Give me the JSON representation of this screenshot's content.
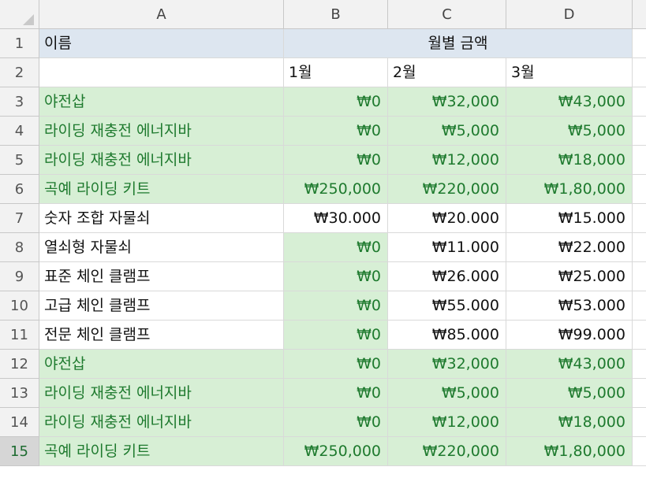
{
  "columns": [
    "A",
    "B",
    "C",
    "D"
  ],
  "row_numbers": [
    "1",
    "2",
    "3",
    "4",
    "5",
    "6",
    "7",
    "8",
    "9",
    "10",
    "11",
    "12",
    "13",
    "14",
    "15"
  ],
  "row1": {
    "a": "이름",
    "merged_title": "월별 금액"
  },
  "row2": {
    "b": "1월",
    "c": "2월",
    "d": "3월"
  },
  "rows": [
    {
      "a": "야전삽",
      "b": "₩0",
      "c": "₩32,000",
      "d": "₩43,000"
    },
    {
      "a": "라이딩 재충전 에너지바",
      "b": "₩0",
      "c": "₩5,000",
      "d": "₩5,000"
    },
    {
      "a": "라이딩 재충전 에너지바",
      "b": "₩0",
      "c": "₩12,000",
      "d": "₩18,000"
    },
    {
      "a": "곡예 라이딩 키트",
      "b": "₩250,000",
      "c": "₩220,000",
      "d": "₩1,80,000"
    },
    {
      "a": "숫자 조합 자물쇠",
      "b": "₩30.000",
      "c": "₩20.000",
      "d": "₩15.000"
    },
    {
      "a": "열쇠형 자물쇠",
      "b": "₩0",
      "c": "₩11.000",
      "d": "₩22.000"
    },
    {
      "a": "표준 체인 클램프",
      "b": "₩0",
      "c": "₩26.000",
      "d": "₩25.000"
    },
    {
      "a": "고급 체인 클램프",
      "b": "₩0",
      "c": "₩55.000",
      "d": "₩53.000"
    },
    {
      "a": "전문 체인 클램프",
      "b": "₩0",
      "c": "₩85.000",
      "d": "₩99.000"
    },
    {
      "a": "야전삽",
      "b": "₩0",
      "c": "₩32,000",
      "d": "₩43,000"
    },
    {
      "a": "라이딩 재충전 에너지바",
      "b": "₩0",
      "c": "₩5,000",
      "d": "₩5,000"
    },
    {
      "a": "라이딩 재충전 에너지바",
      "b": "₩0",
      "c": "₩12,000",
      "d": "₩18,000"
    },
    {
      "a": "곡예 라이딩 키트",
      "b": "₩250,000",
      "c": "₩220,000",
      "d": "₩1,80,000"
    }
  ],
  "colors": {
    "green_fill": "#d7efd5",
    "green_text": "#1e7a2e",
    "header_fill": "#dde6f0",
    "gridline": "#d9d9d9"
  }
}
